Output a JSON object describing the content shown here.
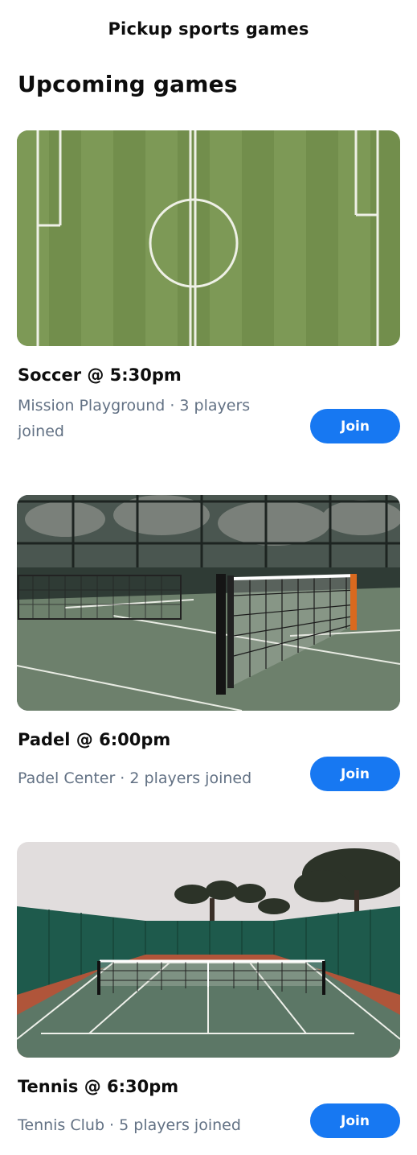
{
  "header": {
    "app_title": "Pickup sports games"
  },
  "section": {
    "title": "Upcoming games"
  },
  "games": [
    {
      "title": "Soccer @ 5:30pm",
      "meta": "Mission Playground · 3 players joined",
      "join_label": "Join",
      "image": "soccer-field-photo"
    },
    {
      "title": "Padel @ 6:00pm",
      "meta": "Padel Center · 2 players joined",
      "join_label": "Join",
      "image": "padel-court-photo"
    },
    {
      "title": "Tennis @ 6:30pm",
      "meta": "Tennis Club · 5 players joined",
      "join_label": "Join",
      "image": "tennis-court-photo"
    }
  ],
  "colors": {
    "accent": "#1778f2",
    "meta_text": "#627184",
    "title_text": "#0d0d0d"
  }
}
